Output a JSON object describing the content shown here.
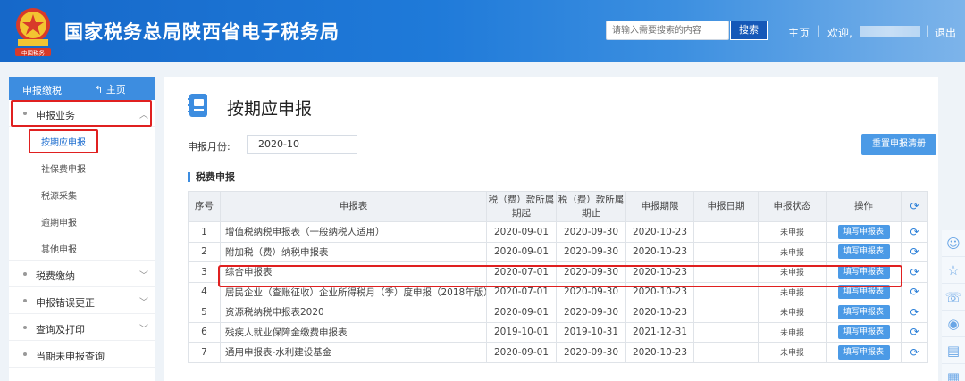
{
  "header": {
    "site_title": "国家税务总局陕西省电子税务局",
    "emblem_caption": "中国税务",
    "search_placeholder": "请输入需要搜索的内容",
    "search_button": "搜索",
    "nav_home": "主页",
    "nav_sep": "|",
    "nav_welcome": "欢迎,",
    "nav_exit": "退出"
  },
  "sidebar": {
    "header_title": "申报缴税",
    "header_home": "主页",
    "items": [
      {
        "label": "申报业务"
      },
      {
        "label": "税费缴纳"
      },
      {
        "label": "申报错误更正"
      },
      {
        "label": "查询及打印"
      },
      {
        "label": "当期未申报查询"
      }
    ],
    "sub_items": [
      {
        "label": "按期应申报"
      },
      {
        "label": "社保费申报"
      },
      {
        "label": "税源采集"
      },
      {
        "label": "逾期申报"
      },
      {
        "label": "其他申报"
      }
    ]
  },
  "main": {
    "page_title": "按期应申报",
    "period_label": "申报月份:",
    "period_value": "2020-10",
    "reset_button": "重置申报清册",
    "section_title": "税费申报",
    "table": {
      "headers": [
        "序号",
        "申报表",
        "税（费）款所属期起",
        "税（费）款所属期止",
        "申报期限",
        "申报日期",
        "申报状态",
        "操作"
      ],
      "action_label": "填写申报表",
      "rows": [
        {
          "no": "1",
          "name": "增值税纳税申报表（一般纳税人适用）",
          "start": "2020-09-01",
          "end": "2020-09-30",
          "deadline": "2020-10-23",
          "date": "",
          "status": "未申报"
        },
        {
          "no": "2",
          "name": "附加税（费）纳税申报表",
          "start": "2020-09-01",
          "end": "2020-09-30",
          "deadline": "2020-10-23",
          "date": "",
          "status": "未申报"
        },
        {
          "no": "3",
          "name": "综合申报表",
          "start": "2020-07-01",
          "end": "2020-09-30",
          "deadline": "2020-10-23",
          "date": "",
          "status": "未申报"
        },
        {
          "no": "4",
          "name": "居民企业（查账征收）企业所得税月（季）度申报（2018年版）",
          "start": "2020-07-01",
          "end": "2020-09-30",
          "deadline": "2020-10-23",
          "date": "",
          "status": "未申报"
        },
        {
          "no": "5",
          "name": "资源税纳税申报表2020",
          "start": "2020-09-01",
          "end": "2020-09-30",
          "deadline": "2020-10-23",
          "date": "",
          "status": "未申报"
        },
        {
          "no": "6",
          "name": "残疾人就业保障金缴费申报表",
          "start": "2019-10-01",
          "end": "2019-10-31",
          "deadline": "2021-12-31",
          "date": "",
          "status": "未申报"
        },
        {
          "no": "7",
          "name": "通用申报表-水利建设基金",
          "start": "2020-09-01",
          "end": "2020-09-30",
          "deadline": "2020-10-23",
          "date": "",
          "status": "未申报"
        }
      ]
    }
  },
  "float_toolbar": [
    "user-icon",
    "star-icon",
    "chat-icon",
    "weibo-icon",
    "message-icon",
    "document-icon"
  ],
  "colors": {
    "header_blue": "#1f7ad9",
    "button_blue": "#4b9ae6",
    "highlight_red": "#e02020"
  }
}
